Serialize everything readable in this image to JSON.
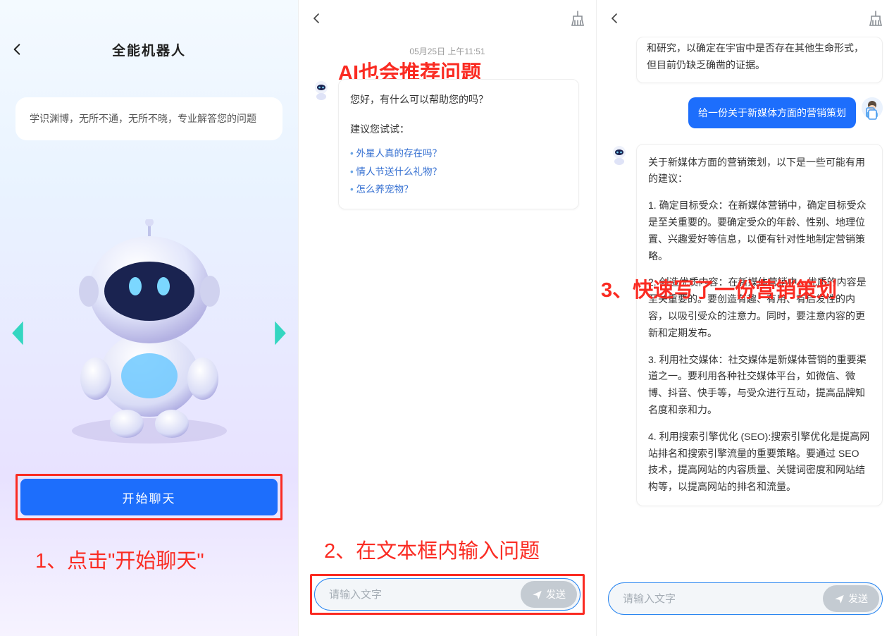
{
  "screen1": {
    "title": "全能机器人",
    "card_text": "学识渊博，无所不通，无所不晓，专业解答您的问题",
    "start_label": "开始聊天",
    "annotation": "1、点击\"开始聊天\""
  },
  "screen2": {
    "timestamp": "05月25日  上午11:51",
    "greeting": "您好，有什么可以帮助您的吗？",
    "suggest_header": "建议您试试：",
    "suggestions": [
      "外星人真的存在吗？",
      "情人节送什么礼物？",
      "怎么养宠物？"
    ],
    "annotation_top": "AI也会推荐问题",
    "annotation_bottom": "2、在文本框内输入问题",
    "input_placeholder": "请输入文字",
    "send_label": "发送"
  },
  "screen3": {
    "partial_ai": "和研究，以确定在宇宙中是否存在其他生命形式，但目前仍缺乏确凿的证据。",
    "user_message": "给一份关于新媒体方面的营销策划",
    "ai_intro": "关于新媒体方面的营销策划，以下是一些可能有用的建议：",
    "ai_points": [
      "1. 确定目标受众：在新媒体营销中，确定目标受众是至关重要的。要确定受众的年龄、性别、地理位置、兴趣爱好等信息，以便有针对性地制定营销策略。",
      "2. 创造优质内容：在新媒体营销中，优质的内容是至关重要的。要创造有趣、有用、有启发性的内容，以吸引受众的注意力。同时，要注意内容的更新和定期发布。",
      "3. 利用社交媒体：社交媒体是新媒体营销的重要渠道之一。要利用各种社交媒体平台，如微信、微博、抖音、快手等，与受众进行互动，提高品牌知名度和亲和力。",
      "4. 利用搜索引擎优化 (SEO):搜索引擎优化是提高网站排名和搜索引擎流量的重要策略。要通过 SEO 技术，提高网站的内容质量、关键词密度和网站结构等，以提高网站的排名和流量。"
    ],
    "annotation": "3、快速写了一份营销策划",
    "input_placeholder": "请输入文字",
    "send_label": "发送"
  }
}
